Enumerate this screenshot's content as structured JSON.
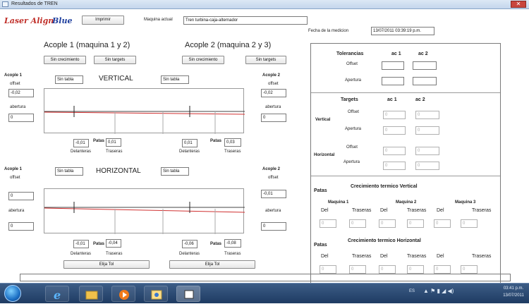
{
  "window": {
    "title": "Resultados de TREN",
    "close": "✕"
  },
  "header": {
    "logo_a": "Laser Align",
    "logo_b": "Blue",
    "print_btn": "Imprimir",
    "machine_label": "Maquina actual",
    "machine_value": "Tren turbina-caja-alternador",
    "date_label": "Fecha de la medicion",
    "date_value": "13/07/2011 03:39:19 p.m."
  },
  "left": {
    "acople1_title": "Acople 1  (maquina 1 y 2)",
    "acople2_title": "Acople 2  (maquina 2 y 3)",
    "btn_sin_crec_1": "Sin crecimiento",
    "btn_sin_targ_1": "Sin targets",
    "btn_sin_crec_2": "Sin crecimiento",
    "btn_sin_targ_2": "Sin targets",
    "vertical": {
      "acople1": "Acople 1",
      "acople2": "Acople 2",
      "tabla1": "Sin tabla",
      "tabla2": "Sin tabla",
      "title": "VERTICAL",
      "offset_l": "offset",
      "offset_r": "offset",
      "offset1": "-0,02",
      "offset2": "-0,02",
      "abertura_l": "abertura",
      "abertura_r": "abertura",
      "ab1": "0",
      "ab2": "0",
      "del1": "-0,01",
      "tras1": "0,01",
      "del2": "0,01",
      "tras2": "0,03",
      "patas": "Patas",
      "delanteras": "Delanteras",
      "traseras": "Traseras"
    },
    "horizontal": {
      "acople1": "Acople 1",
      "acople2": "Acople 2",
      "tabla1": "Sin tabla",
      "tabla2": "Sin tabla",
      "title": "HORIZONTAL",
      "offset_l": "offset",
      "offset_r": "offset",
      "offset1": "0",
      "offset2": "-0,01",
      "abertura_l": "abertura",
      "abertura_r": "abertura",
      "ab1": "0",
      "ab2": "0",
      "del1": "-0,01",
      "tras1": "-0,04",
      "del2": "-0,06",
      "tras2": "-0,08",
      "patas": "Patas",
      "delanteras": "Delanteras",
      "traseras": "Traseras"
    },
    "elija1": "Elija Tol",
    "elija2": "Elija Tol"
  },
  "right": {
    "tol_title": "Tolerancias",
    "ac1": "ac 1",
    "ac2": "ac 2",
    "offset": "Offset",
    "apertura": "Apertura",
    "targets_title": "Targets",
    "vertical": "Vertical",
    "horizontal": "Horizontal",
    "t_val": "0",
    "patas": "Patas",
    "crec_v": "Crecimiento termico Vertical",
    "crec_h": "Crecimiento termico Horizontal",
    "maq1": "Maquina 1",
    "maq2": "Maquina 2",
    "maq3": "Maquina 3",
    "del": "Del",
    "tras": "Traseras",
    "zero": "0"
  },
  "taskbar": {
    "lang": "ES",
    "time": "03:41 p.m.",
    "date": "13/07/2011"
  }
}
